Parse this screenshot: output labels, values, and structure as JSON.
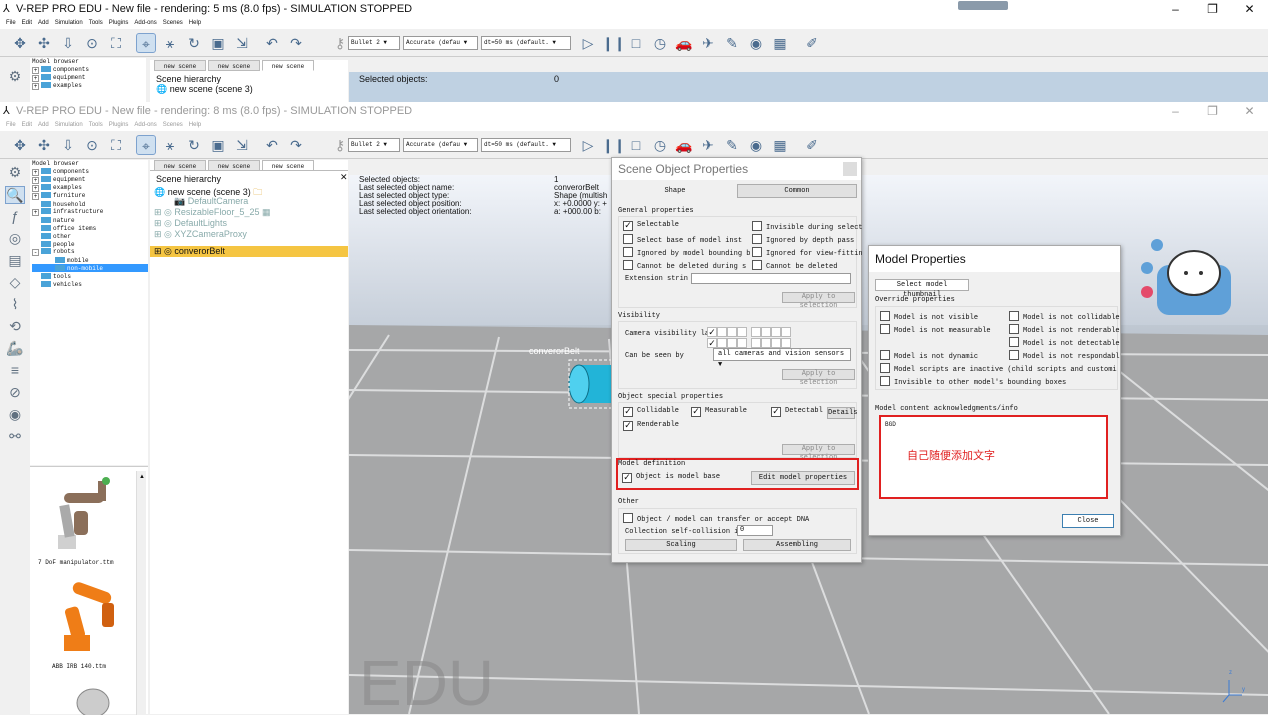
{
  "window_back": {
    "title": "V-REP PRO EDU - New file - rendering: 5 ms (8.0 fps) - SIMULATION STOPPED",
    "menu": [
      "File",
      "Edit",
      "Add",
      "Simulation",
      "Tools",
      "Plugins",
      "Add-ons",
      "Scenes",
      "Help"
    ],
    "tabs": [
      "new scene",
      "new scene",
      "new scene"
    ],
    "model_browser": "Model browser",
    "tree": [
      "components",
      "equipment",
      "examples"
    ],
    "scene_hierarchy": "Scene hierarchy",
    "scene_item": "new scene (scene 3)",
    "selected_label": "Selected objects:",
    "selected_value": "0"
  },
  "window": {
    "title": "V-REP PRO EDU - New file - rendering: 8 ms (8.0 fps) - SIMULATION STOPPED",
    "menu": [
      "File",
      "Edit",
      "Add",
      "Simulation",
      "Tools",
      "Plugins",
      "Add-ons",
      "Scenes",
      "Help"
    ],
    "controls": [
      "–",
      "❐",
      "✕"
    ]
  },
  "toolbar": {
    "engine": "Bullet 2",
    "accuracy": "Accurate (defau",
    "dt": "dt=50 ms (default."
  },
  "tabs": [
    "new scene",
    "new scene",
    "new scene"
  ],
  "model_browser": {
    "title": "Model browser",
    "items": [
      {
        "label": "components",
        "expander": "+"
      },
      {
        "label": "equipment",
        "expander": "+"
      },
      {
        "label": "examples",
        "expander": "+"
      },
      {
        "label": "furniture",
        "expander": "+"
      },
      {
        "label": "household",
        "expander": ""
      },
      {
        "label": "infrastructure",
        "expander": "+"
      },
      {
        "label": "nature",
        "expander": ""
      },
      {
        "label": "office items",
        "expander": ""
      },
      {
        "label": "other",
        "expander": ""
      },
      {
        "label": "people",
        "expander": ""
      },
      {
        "label": "robots",
        "expander": "-"
      },
      {
        "label": "mobile",
        "expander": ""
      },
      {
        "label": "non-mobile",
        "expander": ""
      },
      {
        "label": "tools",
        "expander": ""
      },
      {
        "label": "vehicles",
        "expander": ""
      }
    ],
    "thumbnails": [
      "7 DoF manipulator.ttm",
      "ABB IRB 140.ttm"
    ]
  },
  "scene_hierarchy": {
    "title": "Scene hierarchy",
    "root": "new scene (scene 3)",
    "items": [
      "DefaultCamera",
      "ResizableFloor_5_25",
      "DefaultLights",
      "XYZCameraProxy",
      "converorBelt"
    ]
  },
  "info": {
    "lines": [
      {
        "label": "Selected objects:",
        "value": "1"
      },
      {
        "label": "Last selected object name:",
        "value": "converorBelt"
      },
      {
        "label": "Last selected object type:",
        "value": "Shape (multish"
      },
      {
        "label": "Last selected object position:",
        "value": "x: +0.0000   y: +"
      },
      {
        "label": "Last selected object orientation:",
        "value": "a: +000.00   b:"
      }
    ]
  },
  "scene": {
    "object_label": "converorBelt",
    "watermark": "EDU"
  },
  "sop": {
    "title": "Scene Object Properties",
    "tab_shape": "Shape",
    "tab_common": "Common",
    "general_title": "General properties",
    "general": [
      {
        "label": "Selectable",
        "checked": "✓"
      },
      {
        "label": "Invisible during select",
        "checked": ""
      },
      {
        "label": "Select base of model inst",
        "checked": ""
      },
      {
        "label": "Ignored by depth pass",
        "checked": ""
      },
      {
        "label": "Ignored by model bounding b",
        "checked": ""
      },
      {
        "label": "Ignored for view-fittin",
        "checked": ""
      },
      {
        "label": "Cannot be deleted during s",
        "checked": ""
      },
      {
        "label": "Cannot be deleted",
        "checked": ""
      }
    ],
    "extension": "Extension strin",
    "apply": "Apply to selection",
    "visibility_title": "Visibility",
    "camera_layer": "Camera visibility laye",
    "can_be_seen": "Can be seen by",
    "seen_value": "all cameras and vision sensors",
    "special_title": "Object special properties",
    "special": [
      {
        "label": "Collidable",
        "checked": "✓"
      },
      {
        "label": "Measurable",
        "checked": "✓"
      },
      {
        "label": "Detectabl",
        "checked": "✓"
      },
      {
        "label": "Renderable",
        "checked": "✓"
      }
    ],
    "details": "Details",
    "model_def_title": "Model definition",
    "model_base": "Object is model base",
    "model_base_checked": "✓",
    "edit_model": "Edit model properties",
    "other_title": "Other",
    "dna": "Object / model can transfer or accept DNA",
    "self_collision": "Collection self-collision i",
    "self_collision_value": "0",
    "scaling": "Scaling",
    "assembling": "Assembling"
  },
  "mp": {
    "title": "Model Properties",
    "thumb_button": "Select model thumbnail",
    "override_title": "Override properties",
    "overrides": [
      "Model is not visible",
      "Model is not collidable",
      "Model is not measurable",
      "Model is not renderable",
      "",
      "Model is not detectable",
      "Model is not dynamic",
      "Model is not respondabl"
    ],
    "scripts": "Model scripts are inactive (child scripts and customi",
    "invisible": "Invisible to other model's bounding boxes",
    "ack_title": "Model content acknowledgments/info",
    "ack_text": "BGD",
    "annotation": "自己随便添加文字",
    "close": "Close"
  },
  "colors": {
    "selection": "#f5c542",
    "annotation_red": "#e02020",
    "conveyor": "#22b4d8"
  }
}
